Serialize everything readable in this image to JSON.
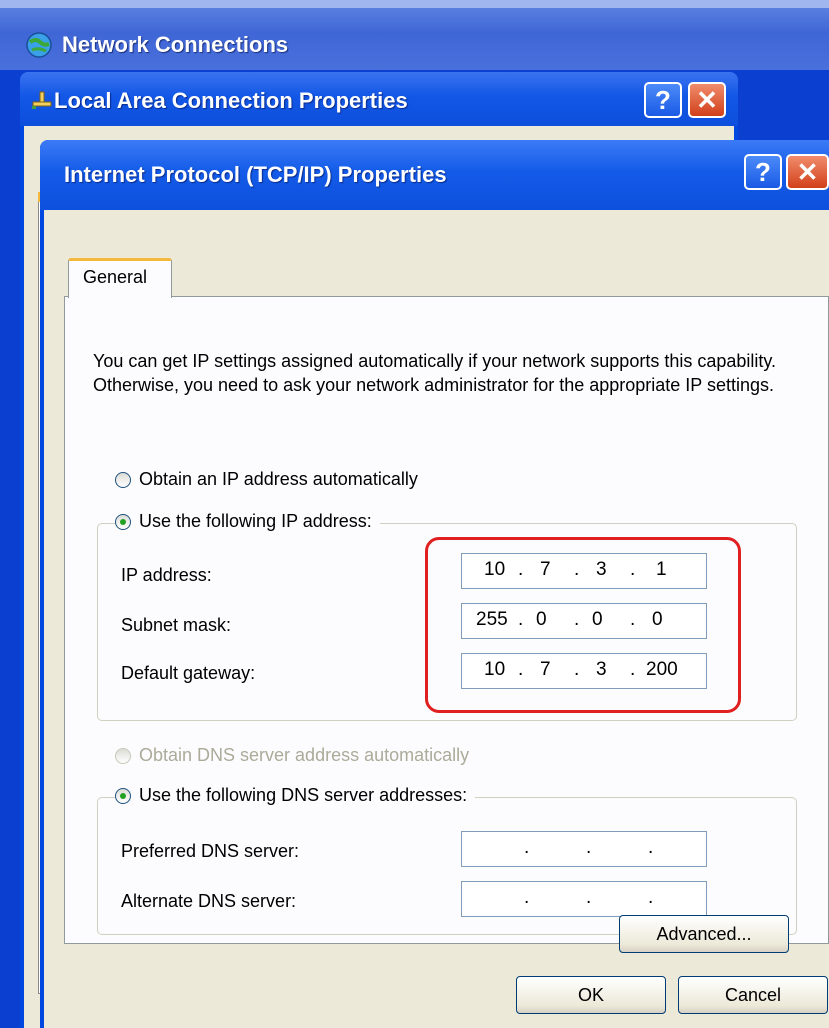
{
  "network_connections": {
    "title": "Network Connections"
  },
  "lac_properties": {
    "title": "Local Area Connection Properties"
  },
  "dialog": {
    "title": "Internet Protocol (TCP/IP) Properties",
    "help_label": "?",
    "close_label": "X",
    "tab_label": "General",
    "description": "You can get IP settings assigned automatically if your network supports this capability. Otherwise, you need to ask your network administrator for the appropriate IP settings.",
    "ip_auto_label": "Obtain an IP address automatically",
    "ip_manual_label": "Use the following IP address:",
    "ip_address_label": "IP address:",
    "subnet_mask_label": "Subnet mask:",
    "default_gateway_label": "Default gateway:",
    "ip_address": [
      "10",
      "7",
      "3",
      "1"
    ],
    "subnet_mask": [
      "255",
      "0",
      "0",
      "0"
    ],
    "default_gateway": [
      "10",
      "7",
      "3",
      "200"
    ],
    "dns_auto_label": "Obtain DNS server address automatically",
    "dns_manual_label": "Use the following DNS server addresses:",
    "preferred_dns_label": "Preferred DNS server:",
    "alternate_dns_label": "Alternate DNS server:",
    "preferred_dns": [
      "",
      "",
      "",
      ""
    ],
    "alternate_dns": [
      "",
      "",
      "",
      ""
    ],
    "advanced_label": "Advanced...",
    "ok_label": "OK",
    "cancel_label": "Cancel"
  },
  "colors": {
    "highlight": "#e02020",
    "xp_blue": "#0048e0"
  }
}
